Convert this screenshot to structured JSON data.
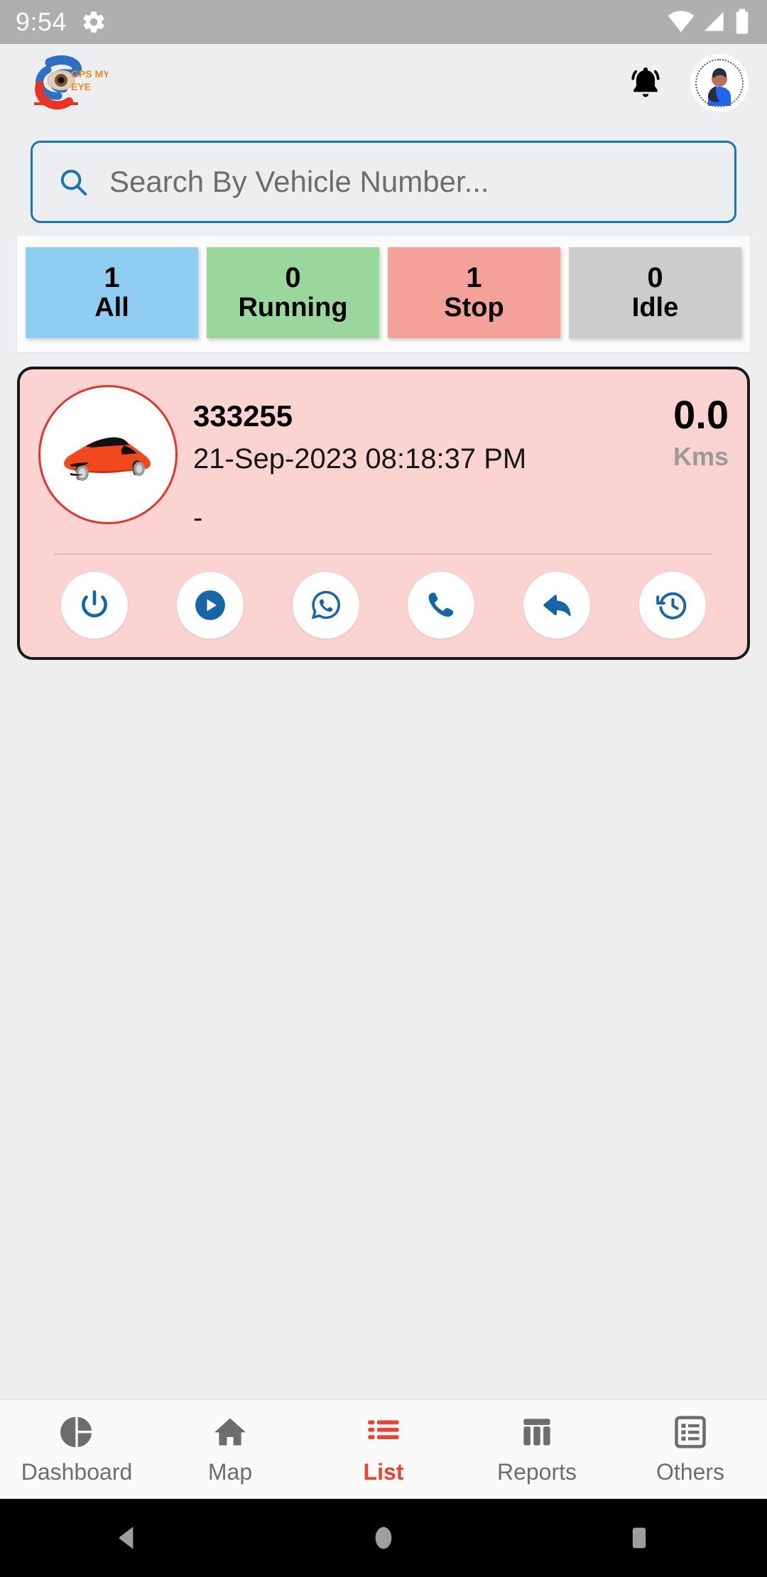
{
  "status_bar": {
    "time": "9:54",
    "icons": [
      "gear-icon",
      "wifi-icon",
      "signal-icon",
      "battery-icon"
    ]
  },
  "header": {
    "logo_text_line1": "GPS MY",
    "logo_text_line2": "EYE",
    "notification_icon": "bell-icon",
    "avatar_icon": "user-avatar"
  },
  "search": {
    "placeholder": "Search By Vehicle Number...",
    "value": "",
    "icon": "search-icon"
  },
  "stats": [
    {
      "value": "1",
      "label": "All",
      "color": "#8fcdf3"
    },
    {
      "value": "0",
      "label": "Running",
      "color": "#9ad79d"
    },
    {
      "value": "1",
      "label": "Stop",
      "color": "#f4a199"
    },
    {
      "value": "0",
      "label": "Idle",
      "color": "#cccccc"
    }
  ],
  "vehicle": {
    "id": "333255",
    "timestamp": "21-Sep-2023 08:18:37 PM",
    "address": "-",
    "distance_value": "0.0",
    "distance_unit": "Kms",
    "thumb_icon": "car-icon",
    "card_color": "#fbd4d1",
    "actions": [
      {
        "name": "power-icon",
        "label": "Power"
      },
      {
        "name": "play-icon",
        "label": "Play"
      },
      {
        "name": "whatsapp-icon",
        "label": "WhatsApp"
      },
      {
        "name": "phone-icon",
        "label": "Call"
      },
      {
        "name": "share-icon",
        "label": "Share"
      },
      {
        "name": "history-icon",
        "label": "History"
      }
    ]
  },
  "bottom_nav": {
    "active_color": "#f0402f",
    "inactive_color": "#6d6d6d",
    "items": [
      {
        "label": "Dashboard",
        "icon": "pie-chart-icon",
        "active": false
      },
      {
        "label": "Map",
        "icon": "home-icon",
        "active": false
      },
      {
        "label": "List",
        "icon": "list-icon",
        "active": true
      },
      {
        "label": "Reports",
        "icon": "bar-chart-icon",
        "active": false
      },
      {
        "label": "Others",
        "icon": "document-list-icon",
        "active": false
      }
    ]
  },
  "android_nav": {
    "back": "back-triangle-icon",
    "home": "home-circle-icon",
    "recents": "recents-square-icon"
  }
}
